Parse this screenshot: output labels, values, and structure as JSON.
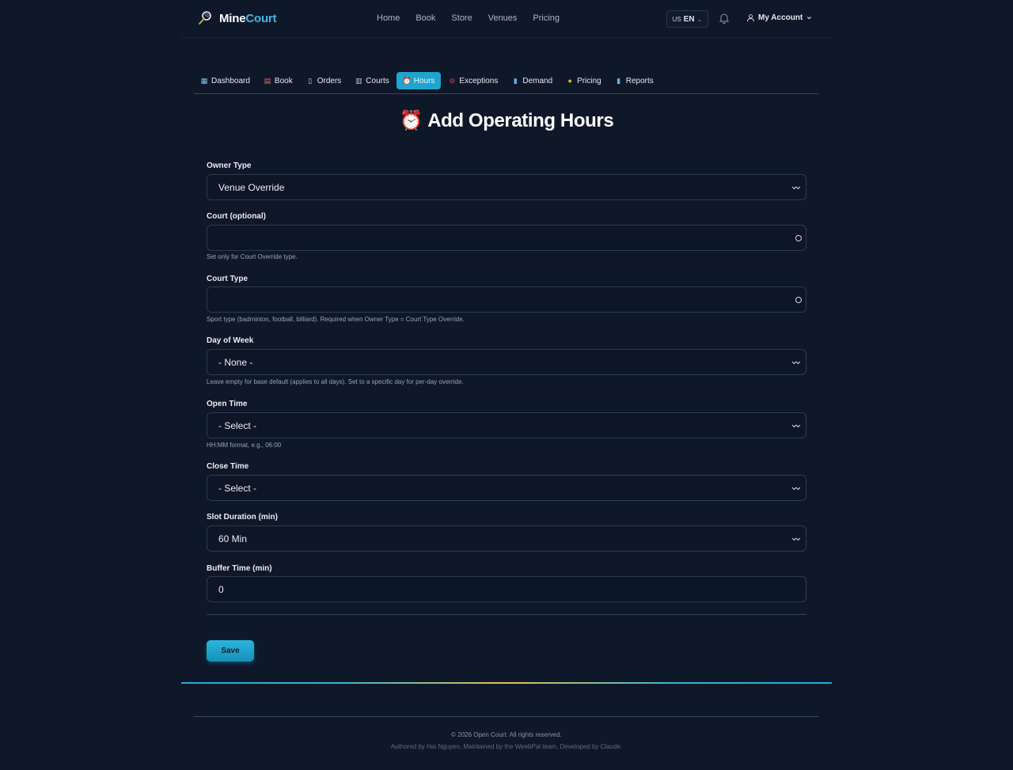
{
  "header": {
    "brand_part1": "Mine",
    "brand_part2": "Court",
    "nav": [
      "Home",
      "Book",
      "Store",
      "Venues",
      "Pricing"
    ],
    "lang_flag": "US",
    "lang_code": "EN",
    "account_label": "My Account"
  },
  "tabs": [
    {
      "icon": "▦",
      "label": "Dashboard"
    },
    {
      "icon": "▤",
      "label": "Book"
    },
    {
      "icon": "▯",
      "label": "Orders"
    },
    {
      "icon": "▥",
      "label": "Courts"
    },
    {
      "icon": "⏰",
      "label": "Hours"
    },
    {
      "icon": "⊘",
      "label": "Exceptions"
    },
    {
      "icon": "▮",
      "label": "Demand"
    },
    {
      "icon": "●",
      "label": "Pricing"
    },
    {
      "icon": "▮",
      "label": "Reports"
    }
  ],
  "page": {
    "title_icon": "⏰",
    "title": "Add Operating Hours"
  },
  "form": {
    "owner_type": {
      "label": "Owner Type",
      "value": "Venue Override"
    },
    "court": {
      "label": "Court (optional)",
      "value": "",
      "help": "Set only for Court Override type."
    },
    "court_type": {
      "label": "Court Type",
      "value": "",
      "help": "Sport type (badminton, football, billiard). Required when Owner Type = Court Type Override."
    },
    "day_of_week": {
      "label": "Day of Week",
      "value": "- None -",
      "help": "Leave empty for base default (applies to all days). Set to a specific day for per-day override."
    },
    "open_time": {
      "label": "Open Time",
      "value": "- Select -",
      "help": "HH:MM format, e.g., 06:00"
    },
    "close_time": {
      "label": "Close Time",
      "value": "- Select -"
    },
    "slot_duration": {
      "label": "Slot Duration (min)",
      "value": "60 Min"
    },
    "buffer_time": {
      "label": "Buffer Time (min)",
      "value": "0"
    },
    "save_label": "Save"
  },
  "footer": {
    "copyright": "© 2026 Open Court. All rights reserved.",
    "credits": "Authored by Hai Nguyen, Maintained by the WeebPal team, Developed by Claude."
  },
  "colors": {
    "background": "#0f1829",
    "accent": "#1fa4cd",
    "brand_accent": "#3fb6e6"
  }
}
